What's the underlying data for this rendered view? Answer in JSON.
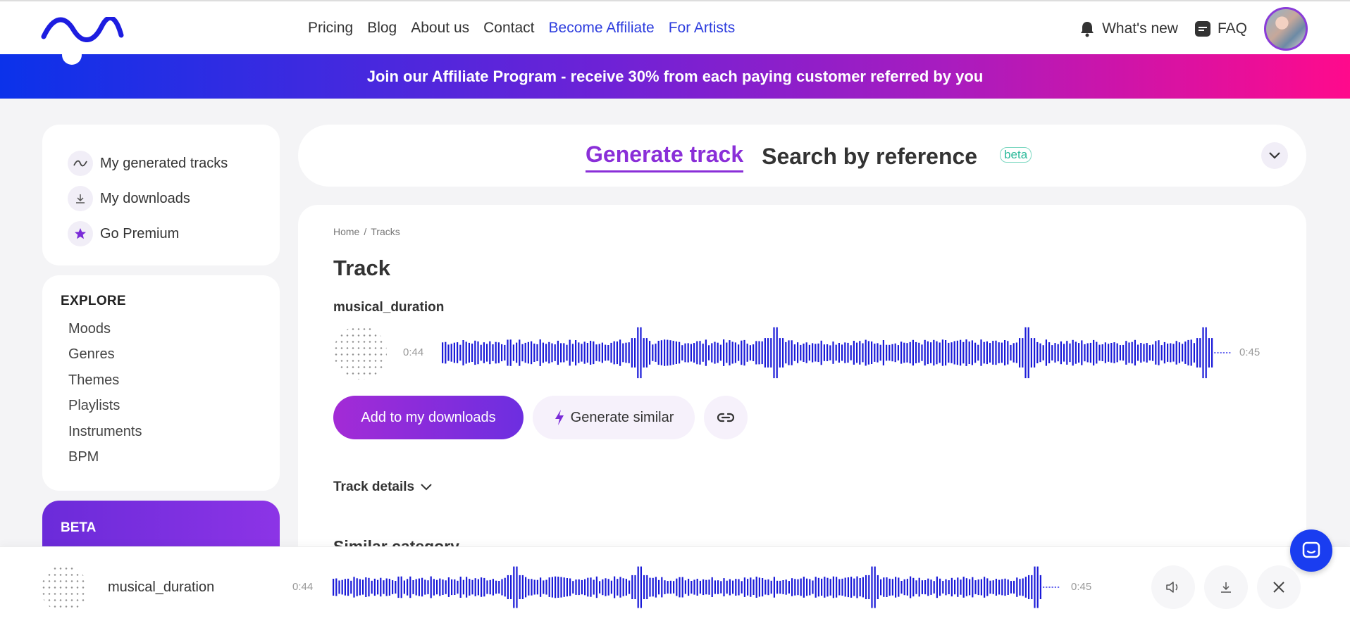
{
  "nav": {
    "links": [
      {
        "label": "Pricing"
      },
      {
        "label": "Blog"
      },
      {
        "label": "About us"
      },
      {
        "label": "Contact"
      },
      {
        "label": "Become Affiliate"
      },
      {
        "label": "For Artists"
      }
    ],
    "whats_new": "What's new",
    "faq": "FAQ"
  },
  "banner": {
    "text": "Join our Affiliate Program - receive 30% from each paying customer referred by you"
  },
  "sidebar": {
    "items": [
      {
        "label": "My generated tracks",
        "icon": "wave-icon"
      },
      {
        "label": "My downloads",
        "icon": "download-icon"
      },
      {
        "label": "Go Premium",
        "icon": "star-icon"
      }
    ],
    "explore": {
      "title": "EXPLORE",
      "items": [
        "Moods",
        "Genres",
        "Themes",
        "Playlists",
        "Instruments",
        "BPM"
      ]
    },
    "beta": {
      "title": "BETA"
    }
  },
  "tabs": {
    "generate": "Generate track",
    "search": "Search by reference",
    "beta_badge": "beta"
  },
  "content": {
    "breadcrumb": [
      "Home",
      "/",
      "Tracks"
    ],
    "title": "Track",
    "track_name": "musical_duration",
    "time_current": "0:44",
    "time_total": "0:45",
    "add_button": "Add to my downloads",
    "similar_button": "Generate similar",
    "details": "Track details",
    "similar_category": "Similar category"
  },
  "player": {
    "track_name": "musical_duration",
    "time_current": "0:44",
    "time_total": "0:45"
  },
  "colors": {
    "accent": "#8a2fd8",
    "wave": "#1a1ad8",
    "link_blue": "#2c3cde"
  }
}
